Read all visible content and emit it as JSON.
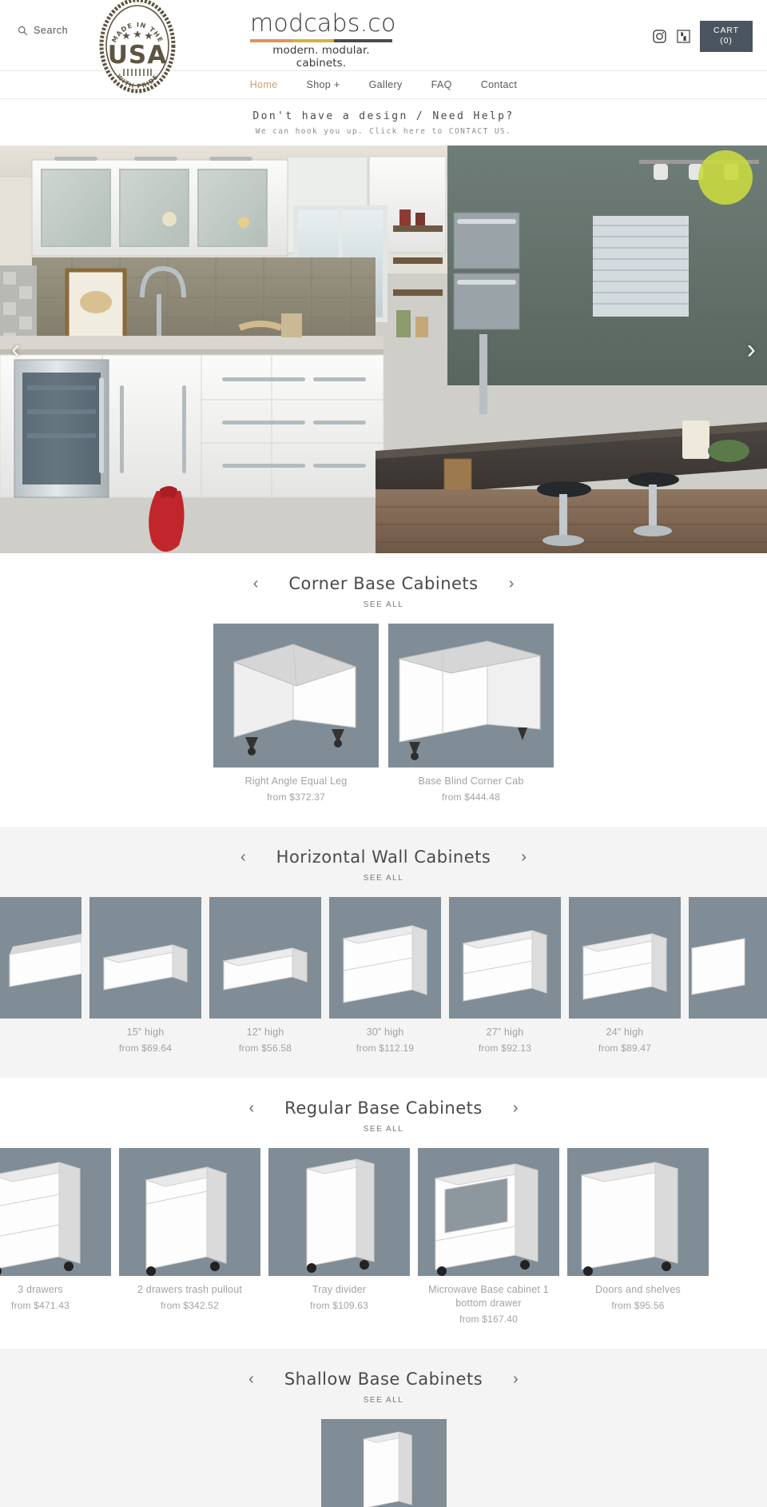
{
  "header": {
    "search_label": "Search",
    "search_icon": "search-icon",
    "badge": {
      "top_text": "MADE IN THE",
      "main_text": "USA",
      "bottom_text": "WITH PRIDE"
    },
    "logo": {
      "main": "modcabs.co",
      "sub": "modern. modular. cabinets.",
      "rule_colors": [
        "#e0915c",
        "#d3b23a",
        "#4b4b4b"
      ]
    },
    "instagram_icon": "instagram-icon",
    "houzz_icon": "houzz-icon",
    "cart_label": "CART",
    "cart_count": "(0)"
  },
  "nav": {
    "items": [
      {
        "label": "Home",
        "active": true
      },
      {
        "label": "Shop +",
        "active": false
      },
      {
        "label": "Gallery",
        "active": false
      },
      {
        "label": "FAQ",
        "active": false
      },
      {
        "label": "Contact",
        "active": false
      }
    ]
  },
  "announcement": {
    "main": "Don't have a design / Need Help?",
    "sub": "We can hook you up. Click here to CONTACT US."
  },
  "hero": {
    "prev_arrow": "‹",
    "next_arrow": "›",
    "alt": "modern white kitchen with wood island and tile backsplash"
  },
  "common": {
    "see_all": "SEE ALL",
    "prev_arrow": "‹",
    "next_arrow": "›",
    "price_prefix": "from"
  },
  "sections": [
    {
      "title": "Corner Base Cabinets",
      "see_all": "SEE ALL",
      "bg": "white",
      "layout": "centered",
      "products": [
        {
          "title": "Right Angle Equal Leg",
          "price": "$372.37",
          "price_full": "from $372.37",
          "shape": "corner-l"
        },
        {
          "title": "Base Blind Corner Cab",
          "price": "$444.48",
          "price_full": "from $444.48",
          "shape": "blind-corner"
        }
      ]
    },
    {
      "title": "Horizontal Wall Cabinets",
      "see_all": "SEE ALL",
      "bg": "grey",
      "layout": "scroll",
      "products": [
        {
          "title": "",
          "price": "",
          "price_full": "",
          "shape": "wall-partial",
          "partial": true
        },
        {
          "title": "15” high",
          "price": "$69.64",
          "price_full": "from $69.64",
          "shape": "wall-short"
        },
        {
          "title": "12” high",
          "price": "$56.58",
          "price_full": "from $56.58",
          "shape": "wall-short"
        },
        {
          "title": "30” high",
          "price": "$112.19",
          "price_full": "from $112.19",
          "shape": "wall-tall"
        },
        {
          "title": "27” high",
          "price": "$92.13",
          "price_full": "from $92.13",
          "shape": "wall-tall"
        },
        {
          "title": "24” high",
          "price": "$89.47",
          "price_full": "from $89.47",
          "shape": "wall-tall"
        },
        {
          "title": "",
          "price": "",
          "price_full": "",
          "shape": "wall-partial",
          "partial": true
        }
      ]
    },
    {
      "title": "Regular Base Cabinets",
      "see_all": "SEE ALL",
      "bg": "white",
      "layout": "scroll",
      "products": [
        {
          "title": "3 drawers",
          "price": "$471.43",
          "price_full": "from $471.43",
          "shape": "base-3drawer"
        },
        {
          "title": "2 drawers trash pullout",
          "price": "$342.52",
          "price_full": "from $342.52",
          "shape": "base-2drawer"
        },
        {
          "title": "Tray divider",
          "price": "$109.63",
          "price_full": "from $109.63",
          "shape": "base-tray"
        },
        {
          "title": "Microwave Base cabinet 1 bottom drawer",
          "price": "$167.40",
          "price_full": "from $167.40",
          "shape": "base-microwave"
        },
        {
          "title": "Doors and shelves",
          "price": "$95.56",
          "price_full": "from $95.56",
          "shape": "base-doors"
        }
      ]
    },
    {
      "title": "Shallow Base Cabinets",
      "see_all": "SEE ALL",
      "bg": "grey",
      "layout": "centered",
      "products": [
        {
          "title": "",
          "price": "",
          "price_full": "",
          "shape": "shallow"
        }
      ]
    }
  ]
}
